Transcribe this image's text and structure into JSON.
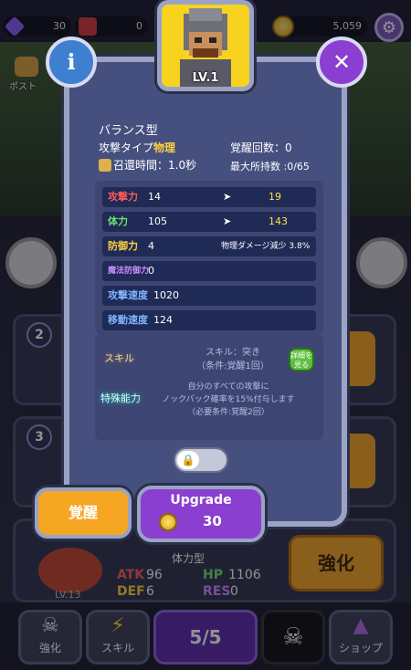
{
  "top": {
    "gems": "30",
    "red_gems": "0",
    "gold": "5,059"
  },
  "background": {
    "post_label": "ポスト",
    "rows": [
      {
        "num": "2"
      },
      {
        "num": "3"
      }
    ],
    "hero": {
      "type_label": "体力型",
      "atk_label": "ATK",
      "atk_value": "96",
      "hp_label": "HP",
      "hp_value": "1106",
      "def_label": "DEF",
      "def_value": "6",
      "res_label": "RES",
      "res_value": "0",
      "level": "LV.13"
    },
    "strengthen_big": "強化"
  },
  "nav": {
    "items": [
      {
        "label": "強化"
      },
      {
        "label": "スキル"
      },
      {
        "label": "ショップ"
      }
    ],
    "center_count": "5/5"
  },
  "modal": {
    "level": "LV.1",
    "hero_type": "バランス型",
    "attack_type_label": "攻撃タイプ",
    "attack_type_value": "物理",
    "summon_time": "召還時間：1.0秒",
    "awaken_count": "覚醒回数：0",
    "max_held": "最大所持数 :0/65",
    "stats": [
      {
        "key": "攻撃力",
        "color": "#ff5a5a",
        "value": "14",
        "next": "19"
      },
      {
        "key": "体力",
        "color": "#6fe06f",
        "value": "105",
        "next": "143"
      },
      {
        "key": "防御力",
        "color": "#ffd23f",
        "value": "4",
        "note": "物理ダメージ減少 3.8%"
      },
      {
        "key": "魔法防御力",
        "color": "#c98bff",
        "value": "0"
      },
      {
        "key": "攻撃速度",
        "color": "#7fb4ff",
        "value": "1020"
      },
      {
        "key": "移動速度",
        "color": "#7fb4ff",
        "value": "124"
      }
    ],
    "skill_label": "スキル",
    "special_label": "特殊能力",
    "skill_name": "スキル：突き",
    "skill_condition": "（条件:覚醒1回）",
    "detail_button": "詳細を見る",
    "special_desc_1": "自分のすべての攻撃に",
    "special_desc_2": "ノックバック確率を15%付与します",
    "special_desc_3": "（必要条件:覚醒2回）",
    "awaken_button": "覚醒",
    "upgrade_label": "Upgrade",
    "upgrade_cost": "30",
    "accent_purple": "#8b3fd1",
    "accent_orange": "#f5a623"
  }
}
